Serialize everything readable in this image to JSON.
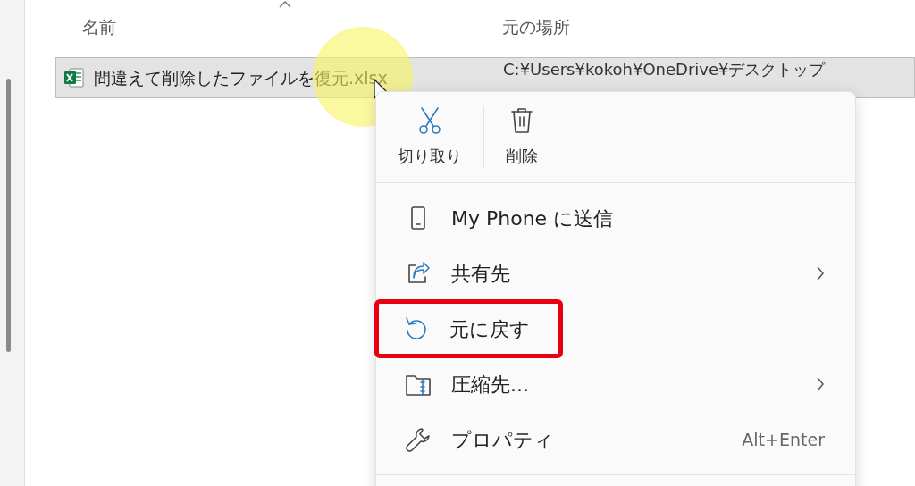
{
  "columns": [
    {
      "label": "名前",
      "sorted": true
    },
    {
      "label": "元の場所",
      "sorted": false
    }
  ],
  "file": {
    "name": "間違えて削除したファイルを復元.xlsx",
    "location": "C:¥Users¥kokoh¥OneDrive¥デスクトップ",
    "selected": true
  },
  "context_menu": {
    "quick_actions": [
      {
        "kind": "cut",
        "label": "切り取り"
      },
      {
        "kind": "delete",
        "label": "削除"
      }
    ],
    "items": [
      {
        "kind": "phone",
        "label": "My Phone に送信",
        "submenu": false,
        "highlighted": false
      },
      {
        "kind": "share",
        "label": "共有先",
        "submenu": true,
        "highlighted": false
      },
      {
        "kind": "restore",
        "label": "元に戻す",
        "submenu": false,
        "highlighted": true
      },
      {
        "kind": "zip",
        "label": "圧縮先...",
        "submenu": true,
        "highlighted": false
      },
      {
        "kind": "properties",
        "label": "プロパティ",
        "shortcut": "Alt+Enter",
        "submenu": false,
        "highlighted": false
      }
    ]
  }
}
